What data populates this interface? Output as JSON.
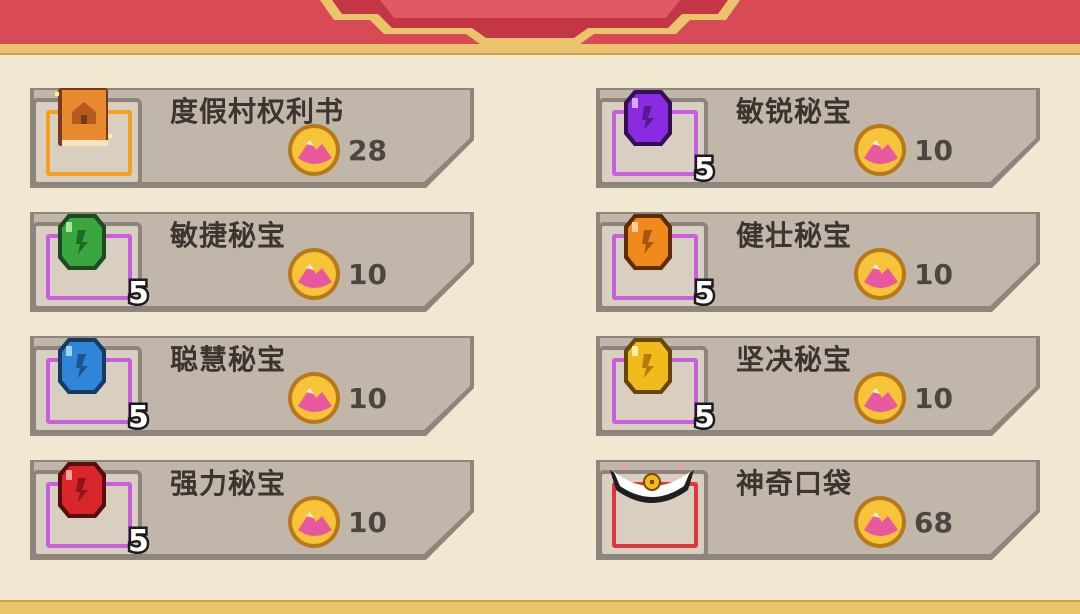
{
  "shop": {
    "items": [
      {
        "name": "度假村权利书",
        "price": "28",
        "count": "",
        "icon": "book-house-icon",
        "color": "#e88a2f"
      },
      {
        "name": "敏捷秘宝",
        "price": "10",
        "count": "5",
        "icon": "green-gem-icon",
        "color": "#3aa63f"
      },
      {
        "name": "聪慧秘宝",
        "price": "10",
        "count": "5",
        "icon": "blue-gem-icon",
        "color": "#2f86d8"
      },
      {
        "name": "强力秘宝",
        "price": "10",
        "count": "5",
        "icon": "red-gem-icon",
        "color": "#d8262b"
      },
      {
        "name": "敏锐秘宝",
        "price": "10",
        "count": "5",
        "icon": "purple-gem-icon",
        "color": "#8a2be2"
      },
      {
        "name": "健壮秘宝",
        "price": "10",
        "count": "5",
        "icon": "orange-gem-icon",
        "color": "#f08a1c"
      },
      {
        "name": "坚决秘宝",
        "price": "10",
        "count": "5",
        "icon": "yellow-gem-icon",
        "color": "#f2bb1c"
      },
      {
        "name": "神奇口袋",
        "price": "68",
        "count": "",
        "icon": "magic-pouch-icon",
        "color": "#d8263a"
      }
    ]
  }
}
